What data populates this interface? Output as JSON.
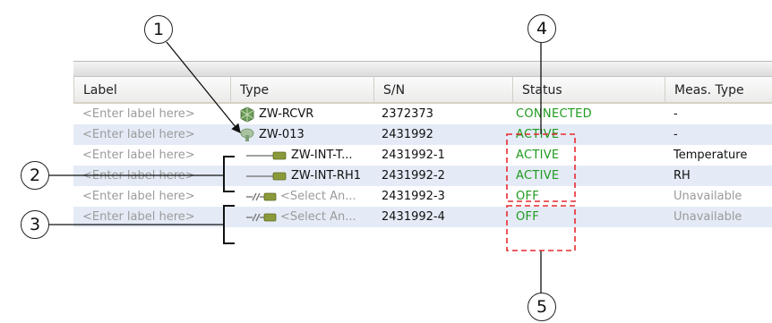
{
  "columns": [
    "Label",
    "Type",
    "S/N",
    "Status",
    "Meas. Type"
  ],
  "rows": [
    {
      "label": "<Enter label here>",
      "type": "ZW-RCVR",
      "sn": "2372373",
      "status": "CONNECTED",
      "meas": "-",
      "icon": "receiver-icon"
    },
    {
      "label": "<Enter label here>",
      "type": "ZW-013",
      "sn": "2431992",
      "status": "ACTIVE",
      "meas": "-",
      "icon": "node-icon"
    },
    {
      "label": "<Enter label here>",
      "type": "ZW-INT-T...",
      "sn": "2431992-1",
      "status": "ACTIVE",
      "meas": "Temperature",
      "icon": "sensor-channel-icon"
    },
    {
      "label": "<Enter label here>",
      "type": "ZW-INT-RH1",
      "sn": "2431992-2",
      "status": "ACTIVE",
      "meas": "RH",
      "icon": "sensor-channel-icon"
    },
    {
      "label": "<Enter label here>",
      "type": "<Select An...",
      "sn": "2431992-3",
      "status": "OFF",
      "meas": "Unavailable",
      "icon": "disconnected-channel-icon"
    },
    {
      "label": "<Enter label here>",
      "type": "<Select An...",
      "sn": "2431992-4",
      "status": "OFF",
      "meas": "Unavailable",
      "icon": "disconnected-channel-icon"
    }
  ],
  "callouts": [
    "1",
    "2",
    "3",
    "4",
    "5"
  ],
  "colors": {
    "status_green": "#1e9a1e",
    "highlight_red": "#e8292e",
    "row_alt": "#e4ebf6"
  }
}
